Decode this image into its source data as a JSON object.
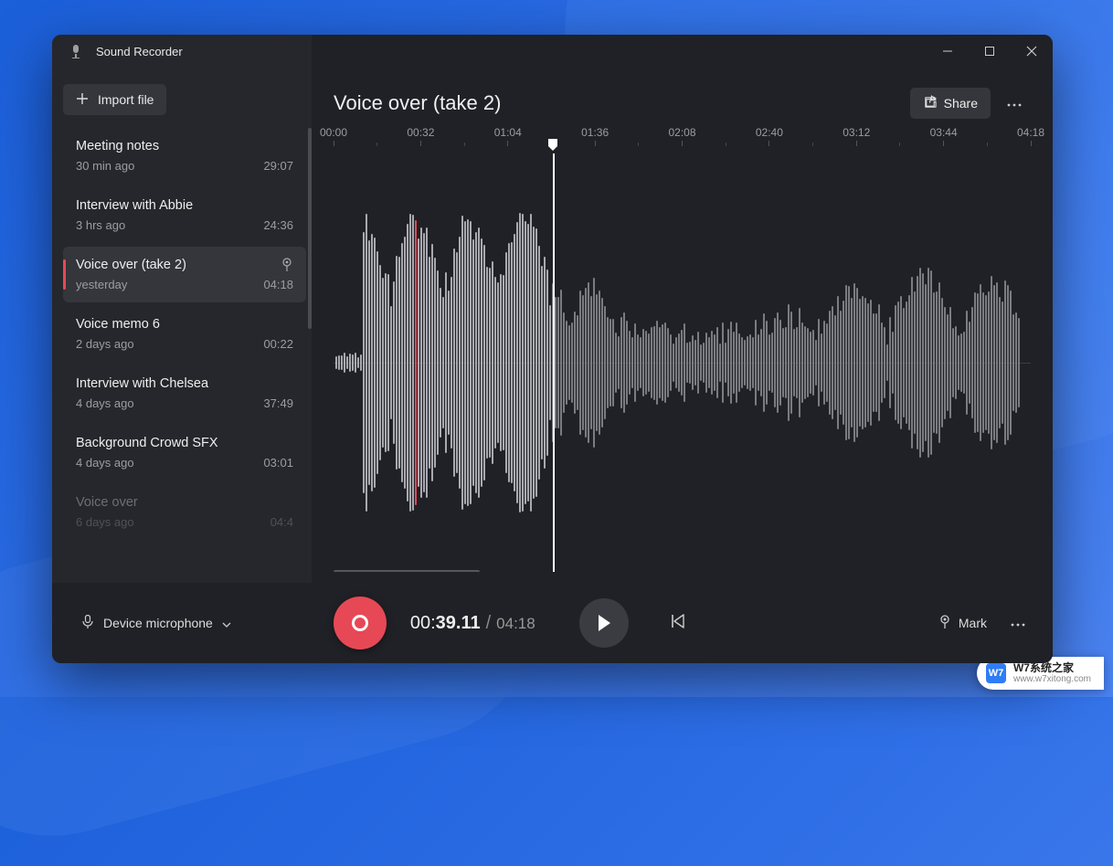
{
  "app": {
    "title": "Sound Recorder"
  },
  "window_controls": {
    "minimize": "—",
    "maximize": "▢",
    "close": "✕"
  },
  "sidebar": {
    "import_label": "Import file",
    "items": [
      {
        "title": "Meeting notes",
        "time_ago": "30 min ago",
        "duration": "29:07",
        "selected": false,
        "has_mark": false
      },
      {
        "title": "Interview with Abbie",
        "time_ago": "3 hrs ago",
        "duration": "24:36",
        "selected": false,
        "has_mark": false
      },
      {
        "title": "Voice over (take 2)",
        "time_ago": "yesterday",
        "duration": "04:18",
        "selected": true,
        "has_mark": true
      },
      {
        "title": "Voice memo 6",
        "time_ago": "2 days ago",
        "duration": "00:22",
        "selected": false,
        "has_mark": false
      },
      {
        "title": "Interview with Chelsea",
        "time_ago": "4 days ago",
        "duration": "37:49",
        "selected": false,
        "has_mark": false
      },
      {
        "title": "Background Crowd SFX",
        "time_ago": "4 days ago",
        "duration": "03:01",
        "selected": false,
        "has_mark": false
      },
      {
        "title": "Voice over",
        "time_ago": "6 days ago",
        "duration": "04:4",
        "selected": false,
        "has_mark": false,
        "faded": true
      }
    ]
  },
  "main": {
    "title": "Voice over (take 2)",
    "share_label": "Share",
    "ruler_ticks": [
      "00:00",
      "00:32",
      "01:04",
      "01:36",
      "02:08",
      "02:40",
      "03:12",
      "03:44",
      "04:18"
    ],
    "playhead_percent": 31.5
  },
  "transport": {
    "mic_label": "Device microphone",
    "current_time_prefix": "00:",
    "current_time_bold": "39.11",
    "separator": "/",
    "total_time": "04:18",
    "mark_label": "Mark"
  },
  "watermark": {
    "logo": "W7",
    "line1": "W7系统之家",
    "line2": "www.w7xitong.com"
  }
}
